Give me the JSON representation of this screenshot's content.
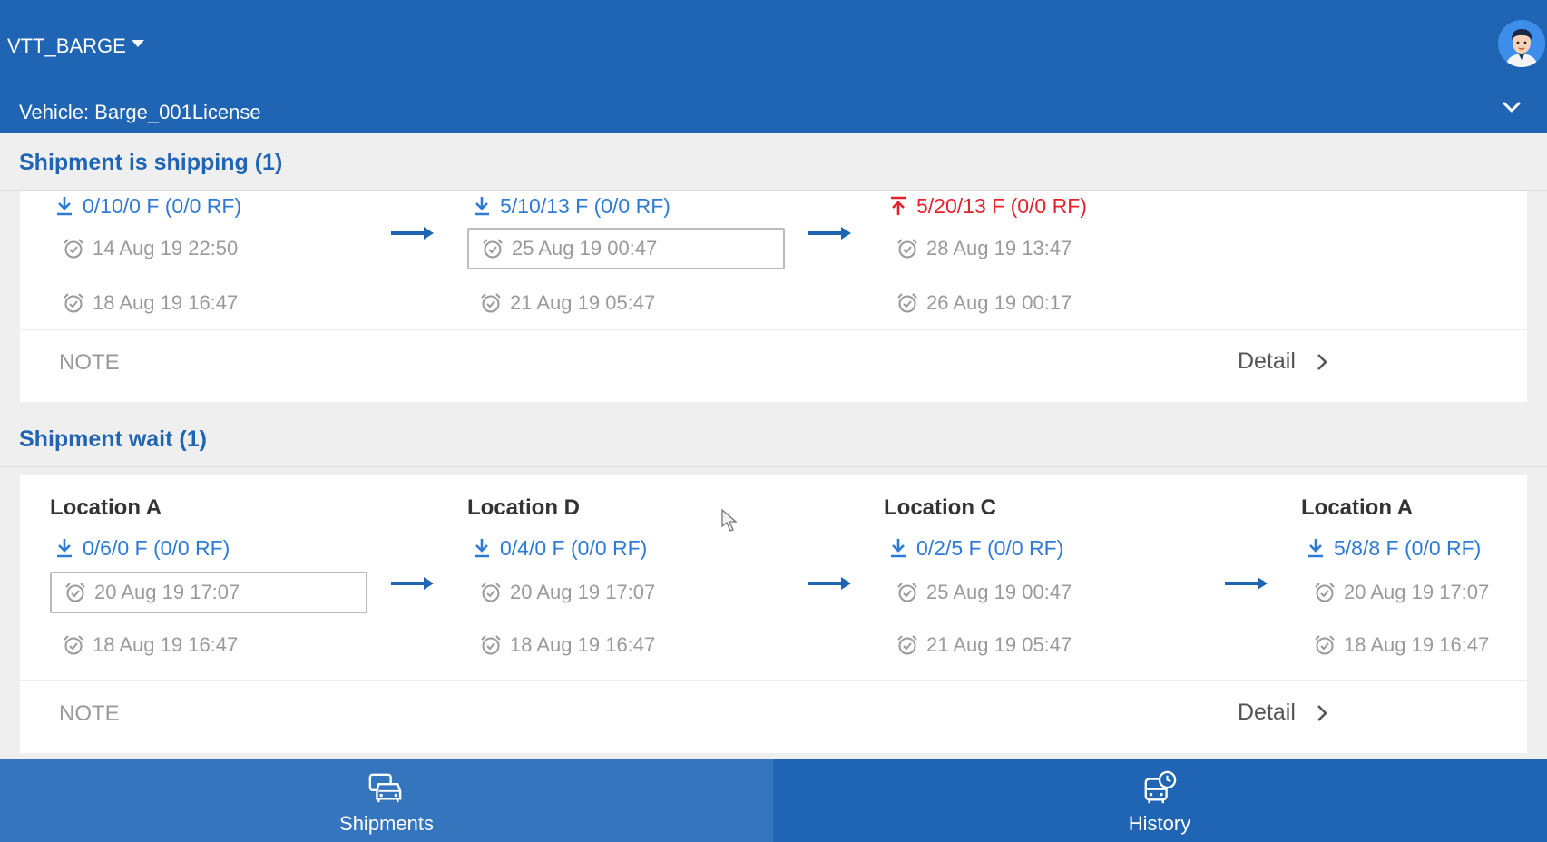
{
  "header": {
    "account": "VTT_BARGE",
    "vehicle": "Vehicle: Barge_001License"
  },
  "shipping": {
    "title": "Shipment is shipping (1)",
    "stops": [
      {
        "qty": "0/10/0 F (0/0 RF)",
        "qty_type": "download",
        "time1": "14 Aug 19 22:50",
        "time2": "18 Aug 19 16:47"
      },
      {
        "qty": "5/10/13 F (0/0 RF)",
        "qty_type": "download",
        "time1": "25 Aug 19 00:47",
        "time2": "21 Aug 19 05:47"
      },
      {
        "qty": "5/20/13 F (0/0 RF)",
        "qty_type": "upload",
        "time1": "28 Aug 19 13:47",
        "time2": "26 Aug 19 00:17"
      }
    ],
    "note": "NOTE",
    "detail": "Detail"
  },
  "wait": {
    "title": "Shipment wait (1)",
    "stops": [
      {
        "location": "Location A",
        "qty": "0/6/0 F (0/0 RF)",
        "time1": "20 Aug 19 17:07",
        "time2": "18 Aug 19 16:47"
      },
      {
        "location": "Location D",
        "qty": "0/4/0 F (0/0 RF)",
        "time1": "20 Aug 19 17:07",
        "time2": "18 Aug 19 16:47"
      },
      {
        "location": "Location C",
        "qty": "0/2/5 F (0/0 RF)",
        "time1": "25 Aug 19 00:47",
        "time2": "21 Aug 19 05:47"
      },
      {
        "location": "Location A",
        "qty": "5/8/8 F (0/0 RF)",
        "time1": "20 Aug 19 17:07",
        "time2": "18 Aug 19 16:47"
      }
    ],
    "note": "NOTE",
    "detail": "Detail"
  },
  "nav": {
    "shipments": "Shipments",
    "history": "History",
    "active": "shipments"
  },
  "colors": {
    "primary": "#1f65b4",
    "link": "#2e7bd6",
    "alert": "#e5222b"
  }
}
